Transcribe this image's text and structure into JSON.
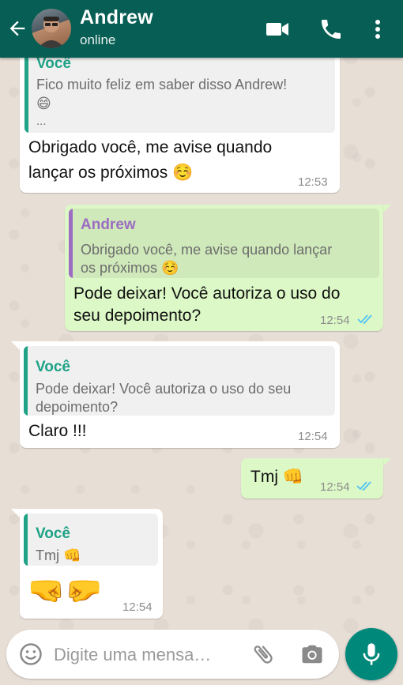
{
  "header": {
    "contact_name": "Andrew",
    "status": "online",
    "icons": [
      "back-arrow-icon",
      "video-call-icon",
      "phone-icon",
      "more-options-icon"
    ]
  },
  "messages": [
    {
      "direction": "in",
      "quote_name": "Você",
      "quote_lines": [
        "Fico muito feliz em saber disso Andrew!",
        "😄",
        "..."
      ],
      "text_lines": [
        "Obrigado você, me avise quando",
        "lançar os próximos ☺️"
      ],
      "time": "12:53"
    },
    {
      "direction": "out",
      "quote_name": "Andrew",
      "quote_lines": [
        "Obrigado você, me avise quando lançar",
        "os próximos ☺️"
      ],
      "text_lines": [
        "Pode deixar! Você autoriza o uso do",
        "seu depoimento?"
      ],
      "time": "12:54",
      "read": true
    },
    {
      "direction": "in",
      "quote_name": "Você",
      "quote_lines": [
        "Pode deixar! Você autoriza o uso do seu",
        "depoimento?"
      ],
      "text_lines": [
        "Claro !!!"
      ],
      "time": "12:54"
    },
    {
      "direction": "out",
      "text_lines": [
        "Tmj 👊"
      ],
      "time": "12:54",
      "read": true
    },
    {
      "direction": "in",
      "quote_name": "Você",
      "quote_lines": [
        "Tmj 👊"
      ],
      "text_lines": [
        "🤜🤛"
      ],
      "time": "12:54"
    }
  ],
  "input": {
    "placeholder": "Digite uma mensa…",
    "icons": [
      "emoji-icon",
      "attach-icon",
      "camera-icon",
      "mic-icon"
    ]
  },
  "colors": {
    "header": "#075e54",
    "outgoing_bubble": "#dcf8c6",
    "incoming_bubble": "#ffffff",
    "quote_you": "#1fa286",
    "quote_andrew": "#9c6cc2",
    "read_ticks": "#4fc3f7",
    "mic_button": "#00897b"
  }
}
